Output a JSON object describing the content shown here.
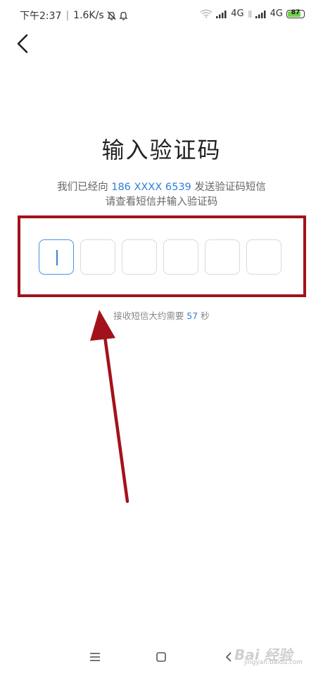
{
  "status_bar": {
    "time": "下午2:37",
    "network_speed": "1.6K/s",
    "signal_1_label": "4G",
    "signal_2_label": "4G",
    "battery_level": "87",
    "battery_fraction": 0.87,
    "icons": [
      "mute-bell-icon",
      "alarm-icon",
      "wifi-icon",
      "signal-icon",
      "battery-icon"
    ]
  },
  "header": {
    "back_icon": "chevron-left-icon"
  },
  "main": {
    "title": "输入验证码",
    "subtitle_prefix": "我们已经向 ",
    "phone_number": "186 XXXX 6539",
    "subtitle_suffix": " 发送验证码短信",
    "subtitle_line2": "请查看短信并输入验证码",
    "code_length": 6,
    "code_values": [
      "",
      "",
      "",
      "",
      "",
      ""
    ],
    "countdown_prefix": "接收短信大约需要 ",
    "countdown_seconds": "57",
    "countdown_suffix": " 秒"
  },
  "nav_bar": {
    "icons": [
      "menu-icon",
      "home-icon",
      "back-icon"
    ]
  },
  "watermark": {
    "main": "Bai 经验",
    "sub": "jingyan.baidu.com"
  },
  "colors": {
    "accent": "#2f80d8",
    "annotation": "#a3121a",
    "battery_fill": "#6fd04a"
  }
}
